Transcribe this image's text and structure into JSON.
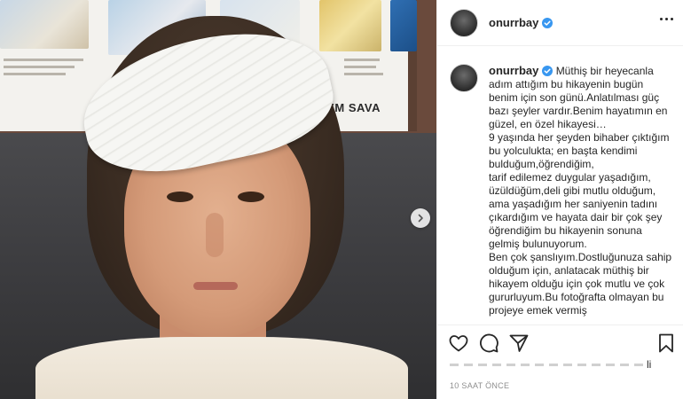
{
  "media": {
    "poster_caption": "N VEREM SAVA",
    "next_icon": "chevron-right-icon"
  },
  "post": {
    "username": "onurrbay",
    "verified_icon": "verified-badge-icon",
    "more_icon": "more-horizontal-icon",
    "caption_lines": [
      "Müthiş bir heyecanla adım attığım bu hikayenin bugün benim için son günü.Anlatılması güç bazı şeyler vardır.Benim hayatımın en güzel, en özel hikayesi…",
      "9 yaşında her şeyden bihaber çıktığım bu yolculukta; en başta kendimi bulduğum,öğrendiğim,",
      "tarif edilemez duygular yaşadığım, üzüldüğüm,deli gibi mutlu olduğum, ama yaşadığım her saniyenin tadını çıkardığım ve hayata dair bir çok şey öğrendiğim bu hikayenin sonuna gelmiş bulunuyorum.",
      "Ben çok şanslıyım.Dostluğunuza sahip olduğum için, anlatacak müthiş bir hikayem olduğu için çok mutlu ve çok gururluyum.Bu fotoğrafta olmayan bu projeye emek vermiş"
    ],
    "likes_tail": "li",
    "timestamp": "10 SAAT ÖNCE"
  },
  "actions": {
    "like_icon": "heart-icon",
    "comment_icon": "comment-icon",
    "share_icon": "share-icon",
    "save_icon": "bookmark-icon"
  },
  "colors": {
    "verified": "#3897f0",
    "text": "#262626",
    "muted": "#8e8e8e",
    "divider": "#efefef"
  }
}
